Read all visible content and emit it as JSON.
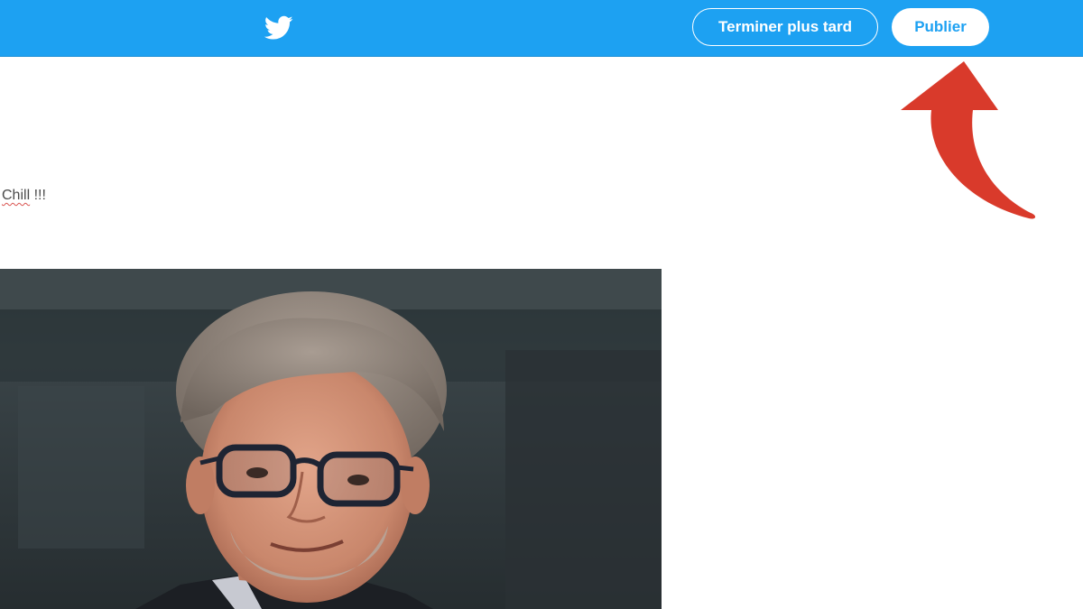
{
  "header": {
    "logo_icon": "twitter-bird-icon",
    "background_color": "#1da1f2",
    "later_label": "Terminer plus tard",
    "publish_label": "Publier"
  },
  "post": {
    "text_word": "Chill",
    "text_rest": " !!!"
  },
  "media": {
    "image_icon": "portrait-photo"
  },
  "annotation": {
    "arrow_icon": "curved-arrow-up-icon",
    "arrow_color": "#d93a2b"
  }
}
